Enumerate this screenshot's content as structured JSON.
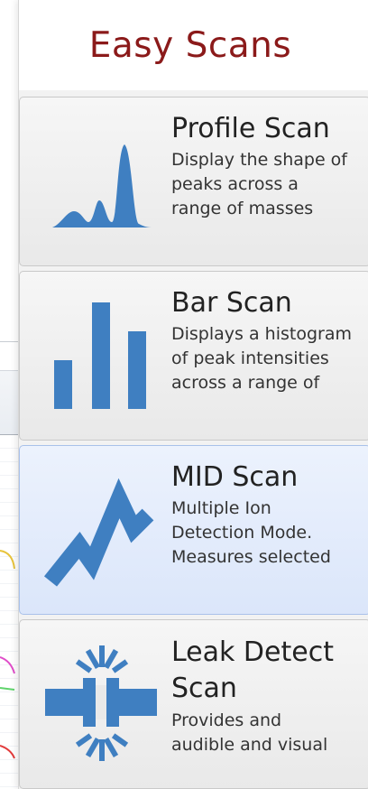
{
  "panel": {
    "title": "Easy Scans"
  },
  "buttons": [
    {
      "title": "Profile Scan",
      "description": "Display the shape of\npeaks across a\nrange of masses",
      "icon": "profile-scan-icon",
      "selected": false
    },
    {
      "title": "Bar Scan",
      "description": "Displays a histogram\nof peak intensities\nacross a range of",
      "icon": "bar-scan-icon",
      "selected": false
    },
    {
      "title": "MID Scan",
      "description": "Multiple Ion\nDetection Mode.\nMeasures selected",
      "icon": "mid-scan-icon",
      "selected": true
    },
    {
      "title": "Leak Detect\nScan",
      "description": "Provides and\naudible and visual",
      "icon": "leak-detect-icon",
      "selected": false
    }
  ],
  "colors": {
    "title": "#8b1a1a",
    "icon": "#3f7fc1",
    "selected_bg": "#dbe6fa",
    "button_bg": "#ececec"
  }
}
